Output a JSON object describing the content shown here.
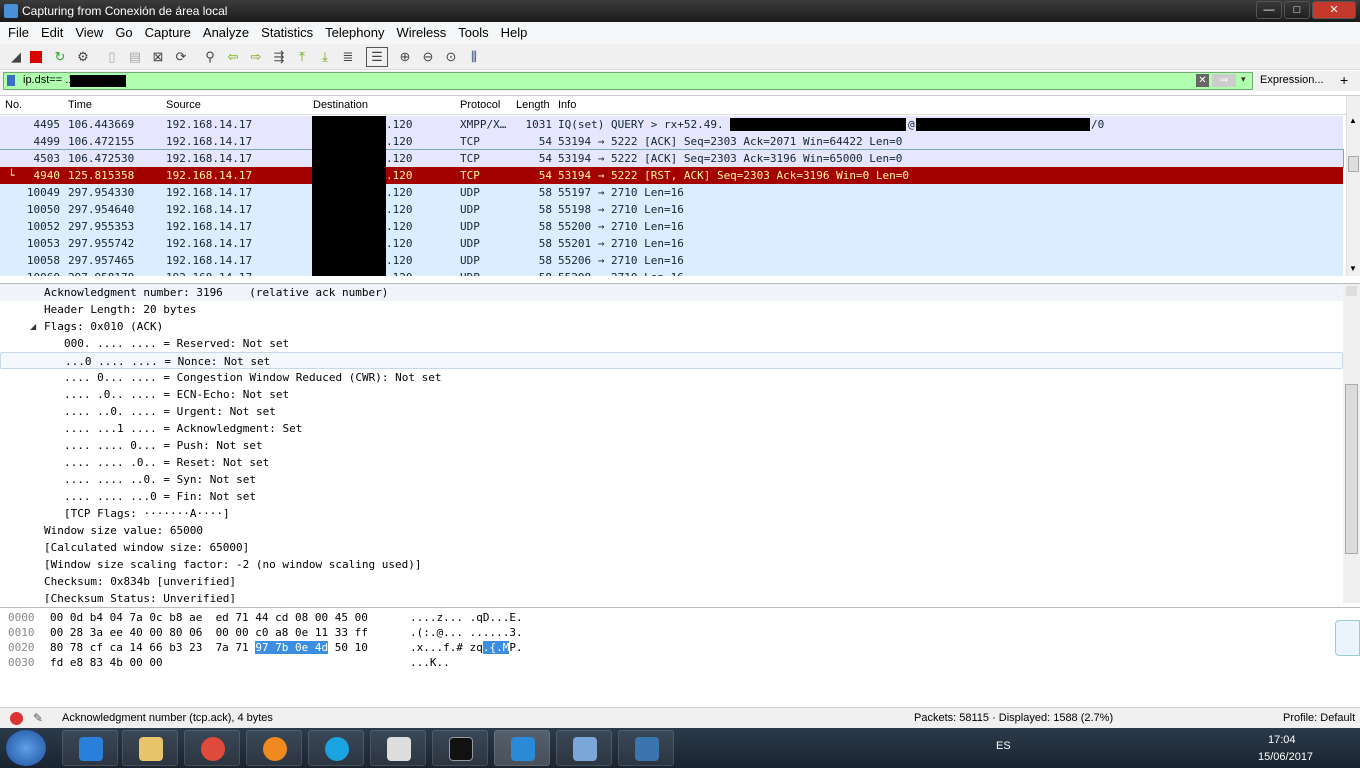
{
  "window": {
    "title": "Capturing from Conexión de área local",
    "minimize": "—",
    "maximize": "□",
    "close": "✕"
  },
  "menu": [
    "File",
    "Edit",
    "View",
    "Go",
    "Capture",
    "Analyze",
    "Statistics",
    "Telephony",
    "Wireless",
    "Tools",
    "Help"
  ],
  "filter": {
    "text": "ip.dst==          .120",
    "expression_label": "Expression...",
    "plus": "+",
    "clear": "✕",
    "apply": "⇒",
    "dropdown": "▾"
  },
  "packet_list": {
    "columns": [
      "No.",
      "Time",
      "Source",
      "Destination",
      "Protocol",
      "Length",
      "Info"
    ],
    "rows": [
      {
        "no": "4495",
        "time": "106.443669",
        "src": "192.168.14.17",
        "dst": ".120",
        "proto": "XMPP/X…",
        "len": "1031",
        "info": "IQ(set) QUERY > rx+52.49.",
        "info_at": "@",
        "info_tail": "/0",
        "style": "xmpp"
      },
      {
        "no": "4499",
        "time": "106.472155",
        "src": "192.168.14.17",
        "dst": ".120",
        "proto": "TCP",
        "len": "54",
        "info": "53194 → 5222 [ACK] Seq=2303 Ack=2071 Win=64422 Len=0",
        "style": "tcp"
      },
      {
        "no": "4503",
        "time": "106.472530",
        "src": "192.168.14.17",
        "dst": ".120",
        "proto": "TCP",
        "len": "54",
        "info": "53194 → 5222 [ACK] Seq=2303 Ack=3196 Win=65000 Len=0",
        "style": "tcp"
      },
      {
        "no": "4940",
        "time": "125.815358",
        "src": "192.168.14.17",
        "dst": ".120",
        "proto": "TCP",
        "len": "54",
        "info": "53194 → 5222 [RST, ACK] Seq=2303 Ack=3196 Win=0 Len=0",
        "style": "sel"
      },
      {
        "no": "10049",
        "time": "297.954330",
        "src": "192.168.14.17",
        "dst": ".120",
        "proto": "UDP",
        "len": "58",
        "info": "55197 → 2710 Len=16",
        "style": "udp"
      },
      {
        "no": "10050",
        "time": "297.954640",
        "src": "192.168.14.17",
        "dst": ".120",
        "proto": "UDP",
        "len": "58",
        "info": "55198 → 2710 Len=16",
        "style": "udp"
      },
      {
        "no": "10052",
        "time": "297.955353",
        "src": "192.168.14.17",
        "dst": ".120",
        "proto": "UDP",
        "len": "58",
        "info": "55200 → 2710 Len=16",
        "style": "udp"
      },
      {
        "no": "10053",
        "time": "297.955742",
        "src": "192.168.14.17",
        "dst": ".120",
        "proto": "UDP",
        "len": "58",
        "info": "55201 → 2710 Len=16",
        "style": "udp"
      },
      {
        "no": "10058",
        "time": "297.957465",
        "src": "192.168.14.17",
        "dst": ".120",
        "proto": "UDP",
        "len": "58",
        "info": "55206 → 2710 Len=16",
        "style": "udp"
      },
      {
        "no": "10060",
        "time": "297.958178",
        "src": "192.168.14.17",
        "dst": ".120",
        "proto": "UDP",
        "len": "58",
        "info": "55208 → 2710 Len=16",
        "style": "udp"
      }
    ]
  },
  "details": [
    "Acknowledgment number: 3196    (relative ack number)",
    "Header Length: 20 bytes",
    "Flags: 0x010 (ACK)",
    "000. .... .... = Reserved: Not set",
    "...0 .... .... = Nonce: Not set",
    ".... 0... .... = Congestion Window Reduced (CWR): Not set",
    ".... .0.. .... = ECN-Echo: Not set",
    ".... ..0. .... = Urgent: Not set",
    ".... ...1 .... = Acknowledgment: Set",
    ".... .... 0... = Push: Not set",
    ".... .... .0.. = Reset: Not set",
    ".... .... ..0. = Syn: Not set",
    ".... .... ...0 = Fin: Not set",
    "[TCP Flags: ·······A····]",
    "Window size value: 65000",
    "[Calculated window size: 65000]",
    "[Window size scaling factor: -2 (no window scaling used)]",
    "Checksum: 0x834b [unverified]",
    "[Checksum Status: Unverified]"
  ],
  "bytes": {
    "offsets": [
      "0000",
      "0010",
      "0020",
      "0030"
    ],
    "hex": [
      "00 0d b4 04 7a 0c b8 ae  ed 71 44 cd 08 00 45 00",
      "00 28 3a ee 40 00 80 06  00 00 c0 a8 0e 11 33 ff",
      "80 78 cf ca 14 66 b3 23  7a 71 ",
      "fd e8 83 4b 00 00"
    ],
    "hex_hl": "97 7b 0e 4d",
    "hex_after": " 50 10",
    "ascii": [
      "....z... .qD...E.",
      ".(:.@... ......3.",
      ".x...f.# zq",
      "...K.."
    ],
    "ascii_hl": ".{.M",
    "ascii_after": "P."
  },
  "status": {
    "field": "Acknowledgment number (tcp.ack), 4 bytes",
    "packets": "Packets: 58115 · Displayed: 1588 (2.7%)",
    "profile": "Profile: Default"
  },
  "taskbar": {
    "lang": "ES",
    "time": "17:04",
    "date": "15/06/2017"
  }
}
